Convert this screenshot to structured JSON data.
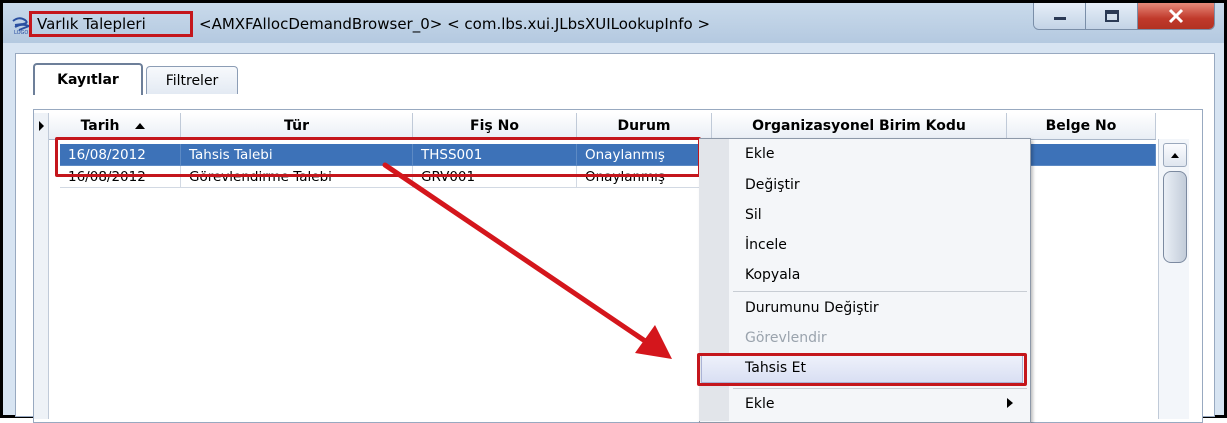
{
  "window": {
    "title_highlight": "Varlık Talepleri",
    "title_rest": "<AMXFAllocDemandBrowser_0> < com.lbs.xui.JLbsXUILookupInfo >"
  },
  "tabs": [
    {
      "label": "Kayıtlar",
      "active": true
    },
    {
      "label": "Filtreler",
      "active": false
    }
  ],
  "table": {
    "columns": [
      "Tarih",
      "Tür",
      "Fiş No",
      "Durum",
      "Organizasyonel Birim Kodu",
      "Belge No"
    ],
    "sort_column": "Tarih",
    "rows": [
      {
        "tarih": "16/08/2012",
        "tur": "Tahsis Talebi",
        "fis_no": "THSS001",
        "durum": "Onaylanmış",
        "selected": true
      },
      {
        "tarih": "16/08/2012",
        "tur": "Görevlendirme Talebi",
        "fis_no": "GRV001",
        "durum": "Onaylanmış",
        "selected": false
      }
    ]
  },
  "context_menu": {
    "items": [
      {
        "label": "Ekle",
        "enabled": true
      },
      {
        "label": "Değiştir",
        "enabled": true
      },
      {
        "label": "Sil",
        "enabled": true
      },
      {
        "label": "İncele",
        "enabled": true
      },
      {
        "label": "Kopyala",
        "enabled": true
      },
      {
        "label": "Durumunu Değiştir",
        "enabled": true
      },
      {
        "label": "Görevlendir",
        "enabled": false
      },
      {
        "label": "Tahsis Et",
        "enabled": true,
        "highlighted": true
      },
      {
        "label": "Ekle",
        "enabled": true,
        "submenu": true
      }
    ]
  },
  "colors": {
    "highlight_border": "#c4161c",
    "selection": "#3d72b8",
    "arrow": "#d4161c"
  }
}
